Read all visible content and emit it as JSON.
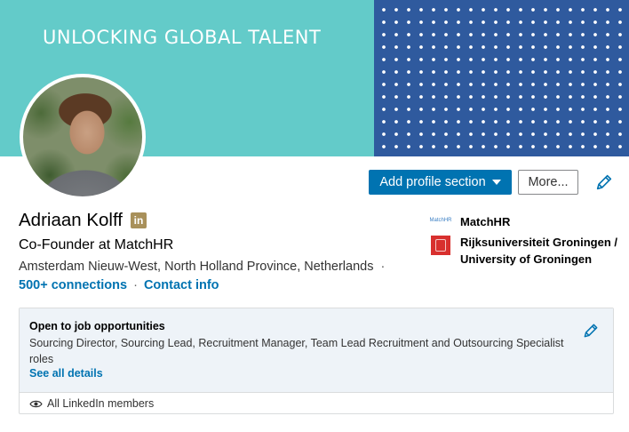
{
  "banner": {
    "tagline": "UNLOCKING GLOBAL TALENT"
  },
  "actions": {
    "add_section_label": "Add profile section",
    "more_label": "More..."
  },
  "profile": {
    "name": "Adriaan Kolff",
    "headline": "Co-Founder at MatchHR",
    "location": "Amsterdam Nieuw-West, North Holland Province, Netherlands",
    "location_sep": "·",
    "connections": "500+ connections",
    "links_sep": "·",
    "contact_info": "Contact info",
    "badge_text": "in"
  },
  "companies": [
    {
      "name": "MatchHR",
      "logo_text": "MatchHR"
    },
    {
      "name": "Rijksuniversiteit Groningen / University of Groningen"
    }
  ],
  "job_card": {
    "title": "Open to job opportunities",
    "roles": "Sourcing Director, Sourcing Lead, Recruitment Manager, Team Lead Recruitment and Outsourcing Specialist roles",
    "see_all": "See all details",
    "visibility": "All LinkedIn members"
  },
  "colors": {
    "primary": "#0073b1",
    "banner": "#63cbc9",
    "banner_dots": "#2f5a9e",
    "badge": "#a8905a"
  },
  "icons": {
    "edit": "pencil-icon",
    "visibility": "eye-icon",
    "dropdown": "caret-down-icon"
  }
}
